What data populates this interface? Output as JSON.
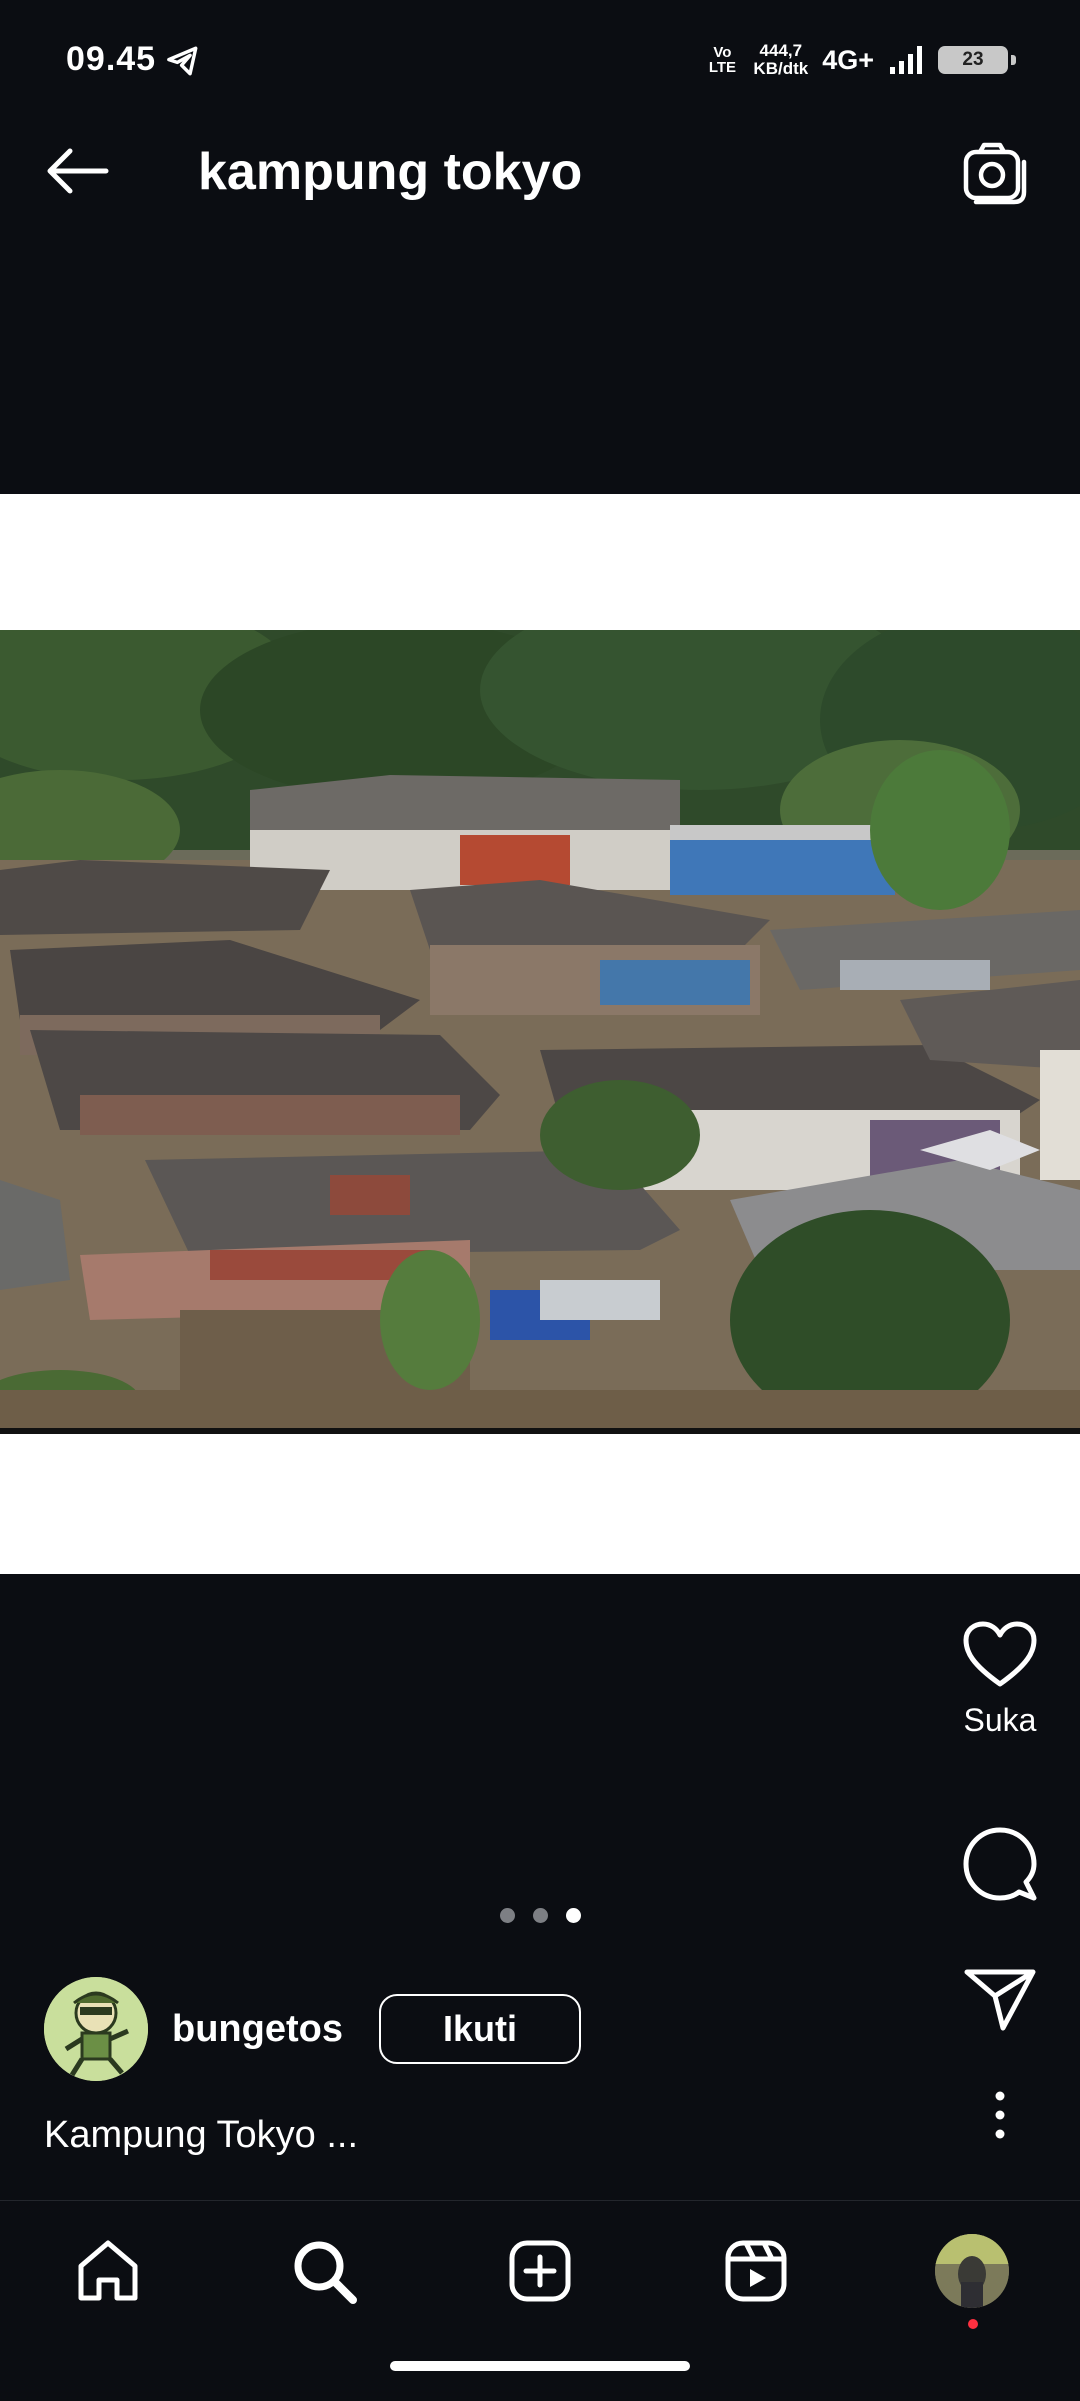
{
  "status_bar": {
    "time": "09.45",
    "volte": "Vo LTE",
    "speed_value": "444,7",
    "speed_unit": "KB/dtk",
    "network": "4G+",
    "battery": "23"
  },
  "header": {
    "title": "kampung tokyo"
  },
  "post": {
    "like_label": "Suka",
    "carousel": {
      "count": 3,
      "active_index": 2
    },
    "username": "bungetos",
    "follow_label": "Ikuti",
    "caption": "Kampung Tokyo ..."
  },
  "icons": {
    "telegram": "telegram-icon",
    "back": "arrow-left-icon",
    "camera": "camera-icon",
    "like": "heart-icon",
    "comment": "comment-bubble-icon",
    "share": "send-icon",
    "more": "more-vertical-icon",
    "home": "home-icon",
    "search": "search-icon",
    "create": "plus-square-icon",
    "reels": "reels-icon"
  },
  "colors": {
    "background": "#0b0d12",
    "notification_dot": "#ff3040"
  }
}
